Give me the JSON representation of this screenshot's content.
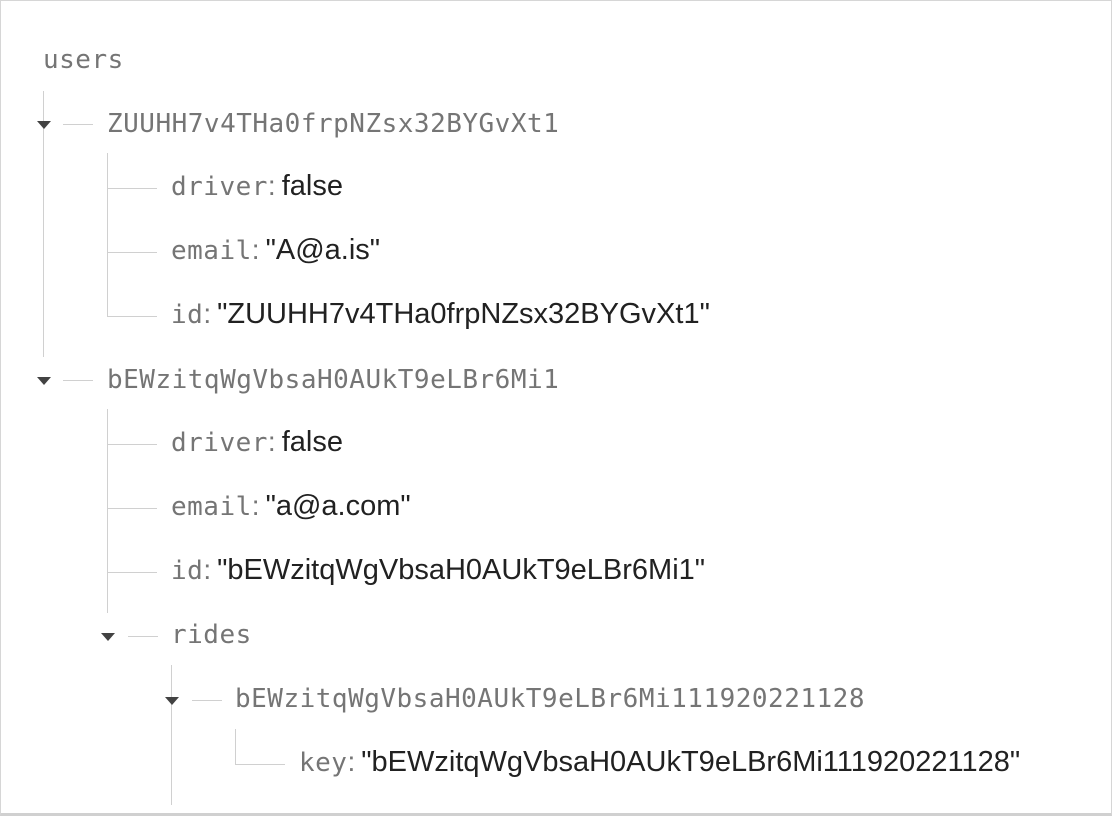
{
  "root": {
    "key": "users"
  },
  "users": [
    {
      "id_key": "ZUUHH7v4THa0frpNZsx32BYGvXt1",
      "fields": [
        {
          "key": "driver",
          "value": "false"
        },
        {
          "key": "email",
          "value": "\"A@a.is\""
        },
        {
          "key": "id",
          "value": "\"ZUUHH7v4THa0frpNZsx32BYGvXt1\""
        }
      ]
    },
    {
      "id_key": "bEWzitqWgVbsaH0AUkT9eLBr6Mi1",
      "fields": [
        {
          "key": "driver",
          "value": "false"
        },
        {
          "key": "email",
          "value": "\"a@a.com\""
        },
        {
          "key": "id",
          "value": "\"bEWzitqWgVbsaH0AUkT9eLBr6Mi1\""
        }
      ],
      "rides": {
        "key": "rides",
        "items": [
          {
            "id_key": "bEWzitqWgVbsaH0AUkT9eLBr6Mi111920221128",
            "fields": [
              {
                "key": "key",
                "value": "\"bEWzitqWgVbsaH0AUkT9eLBr6Mi111920221128\""
              }
            ]
          }
        ]
      }
    }
  ]
}
